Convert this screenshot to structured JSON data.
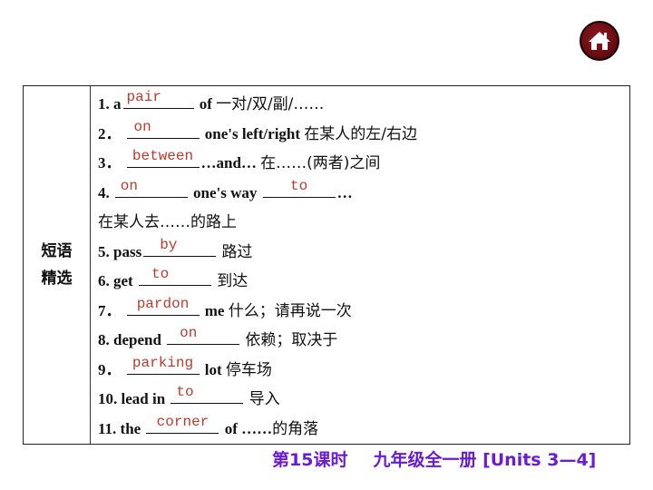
{
  "nav": {
    "home_icon": "home-icon"
  },
  "category": {
    "line1": "短语",
    "line2": "精选"
  },
  "items": [
    {
      "num": "1. a",
      "answer": "pair",
      "after": " of ",
      "zh": "一对/双/副/……"
    },
    {
      "num": "2．",
      "answer": "on",
      "after": " one's left/right ",
      "zh": "在某人的左/右边"
    },
    {
      "num": "3．",
      "answer": "between",
      "after": "…and… ",
      "zh": "在……(两者)之间"
    },
    {
      "num": "4.",
      "answer": "on",
      "after": " one's way ",
      "answer2": "to",
      "after2": "…"
    },
    {
      "zh": "在某人去……的路上"
    },
    {
      "num": "5. pass",
      "answer": "by",
      "zh": "路过"
    },
    {
      "num": "6.  get",
      "answer": "to",
      "zh": "到达"
    },
    {
      "num": "7．",
      "answer": "pardon",
      "after": " me ",
      "zh": "什么；请再说一次"
    },
    {
      "num": "8. depend",
      "answer": "on",
      "zh": "依赖；取决于"
    },
    {
      "num": "9．",
      "answer": "parking",
      "after": " lot  ",
      "zh": "停车场"
    },
    {
      "num": "10. lead in",
      "answer": "to",
      "zh": "导入"
    },
    {
      "num": "11. the",
      "answer": "corner",
      "after": " of ……",
      "zh": "的角落"
    }
  ],
  "footer": {
    "lesson": "第15课时",
    "book": "九年级全一册 [Units 3—4]"
  },
  "colors": {
    "answer": "#c0392b",
    "footer": "#6a1bd6",
    "home": "#6b0d12"
  }
}
